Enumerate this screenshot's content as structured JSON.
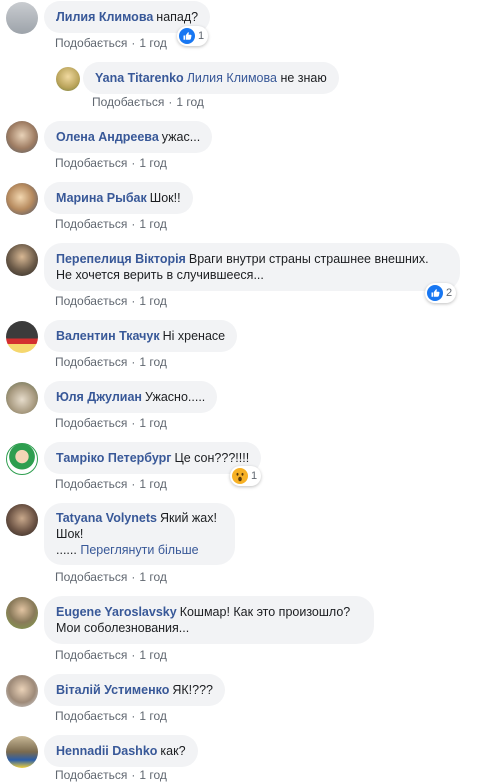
{
  "like_label": "Подобається",
  "sep": "·",
  "comments": [
    {
      "author": "Лилия Климова",
      "text": "напад?",
      "time": "1 год",
      "reaction_count": "1",
      "reaction_type": "like"
    },
    {
      "author": "Yana Titarenko",
      "mention": "Лилия Климова",
      "text": "не знаю",
      "time": "1 год"
    },
    {
      "author": "Олена Андреева",
      "text": "ужас...",
      "time": "1 год"
    },
    {
      "author": "Марина Рыбак",
      "text": "Шок!!",
      "time": "1 год"
    },
    {
      "author": "Перепелиця Вікторія",
      "text_line1": "Враги внутри страны страшнее внешних.",
      "text_line2": "Не хочется верить в случившееся...",
      "time": "1 год",
      "reaction_count": "2",
      "reaction_type": "like"
    },
    {
      "author": "Валентин Ткачук",
      "text": "Ні хренасе",
      "time": "1 год"
    },
    {
      "author": "Юля Джулиан",
      "text": "Ужасно.....",
      "time": "1 год"
    },
    {
      "author": "Тамріко Петербург",
      "text": "Це сон???!!!!",
      "time": "1 год",
      "reaction_count": "1",
      "reaction_type": "wow"
    },
    {
      "author": "Tatyana Volynets",
      "text_line1": "Який жах!",
      "text_line2": "Шок!",
      "text_line3_prefix": "......",
      "see_more": "Переглянути більше",
      "time": "1 год"
    },
    {
      "author": "Eugene Yaroslavsky",
      "text_line1": "Кошмар! Как это произошло?",
      "text_line2": "Мои соболезнования...",
      "time": "1 год"
    },
    {
      "author": "Віталій Устименко",
      "text": "ЯК!???",
      "time": "1 год"
    },
    {
      "author": "Hennadii Dashko",
      "text": "как?",
      "time": "1 год"
    }
  ],
  "colors": {
    "link": "#385898",
    "bubble": "#f2f3f5",
    "meta": "#606770",
    "like_blue": "#1877f2",
    "wow_yellow": "#f7b125"
  }
}
